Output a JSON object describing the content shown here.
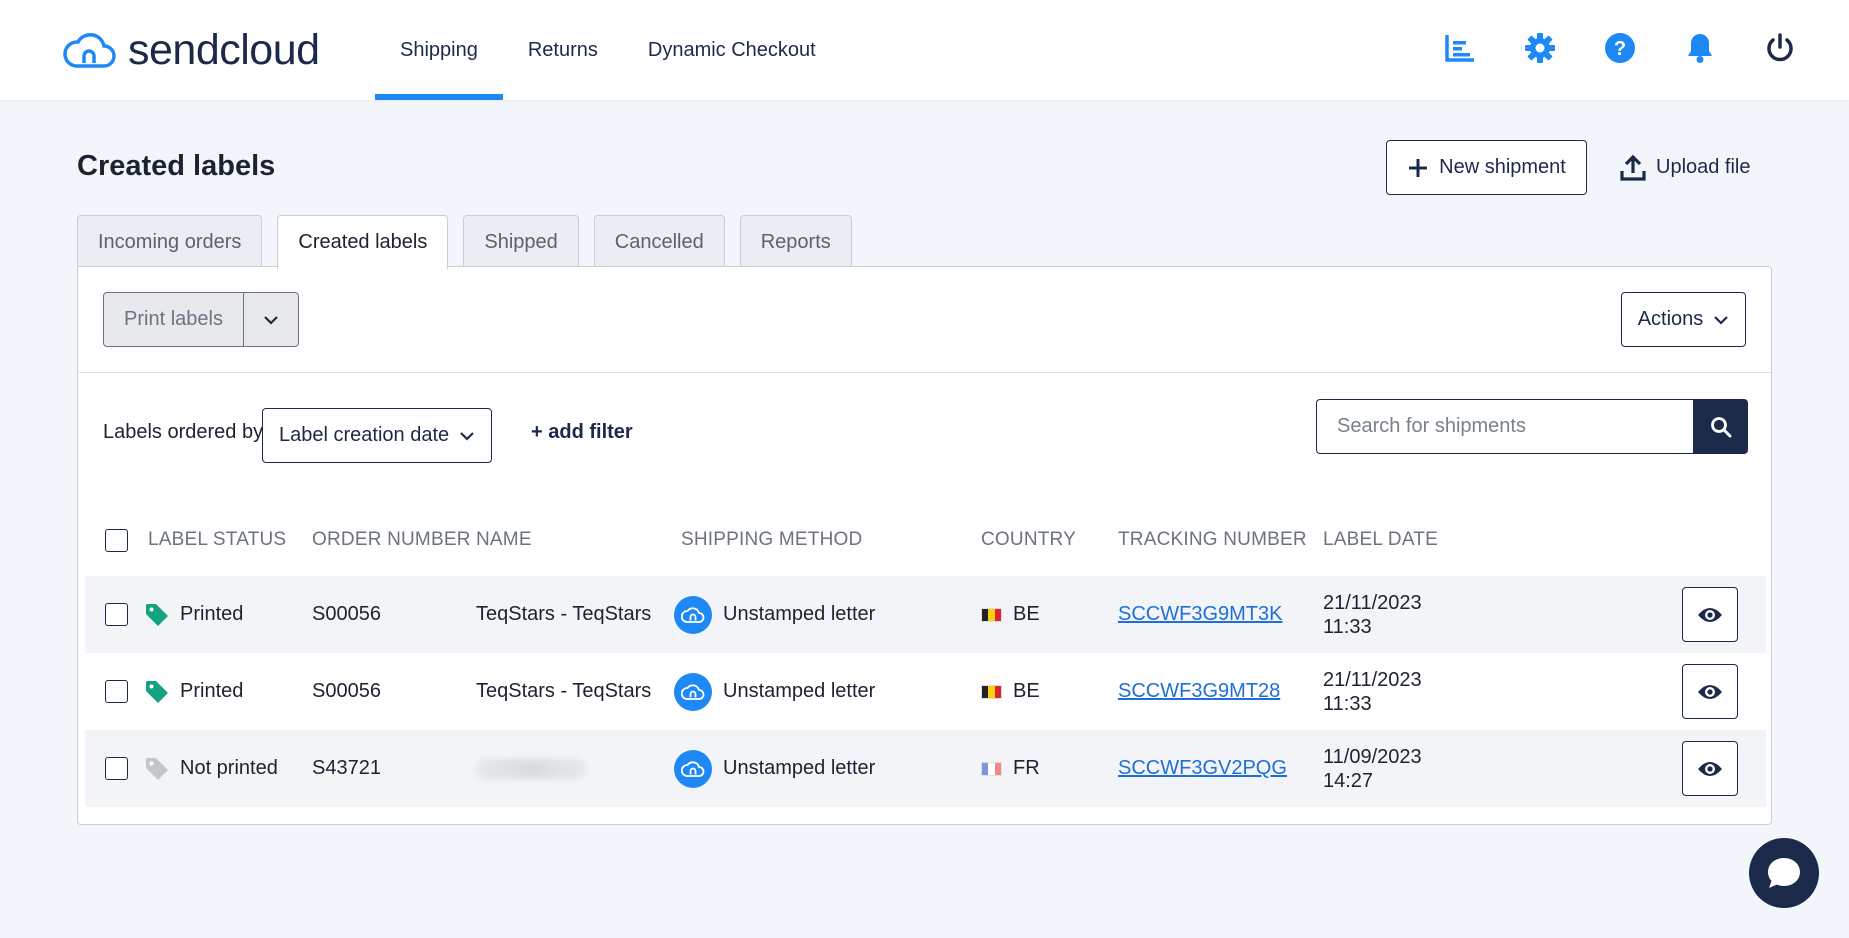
{
  "brand": {
    "name": "sendcloud",
    "accent": "#1e88f5",
    "navy": "#1c2a4a"
  },
  "nav": {
    "items": [
      {
        "label": "Shipping",
        "active": true
      },
      {
        "label": "Returns",
        "active": false
      },
      {
        "label": "Dynamic Checkout",
        "active": false
      }
    ],
    "icons": [
      "analytics-icon",
      "gear-icon",
      "help-icon",
      "bell-icon",
      "power-icon"
    ]
  },
  "page": {
    "title": "Created labels",
    "new_shipment": "New shipment",
    "upload_file": "Upload file"
  },
  "tabs": [
    {
      "label": "Incoming orders",
      "active": false
    },
    {
      "label": "Created labels",
      "active": true
    },
    {
      "label": "Shipped",
      "active": false
    },
    {
      "label": "Cancelled",
      "active": false
    },
    {
      "label": "Reports",
      "active": false
    }
  ],
  "toolbar": {
    "print_labels": "Print labels",
    "actions": "Actions",
    "ordered_by_label": "Labels ordered by",
    "ordered_by_value": "Label creation date",
    "add_filter": "+ add filter",
    "search_placeholder": "Search for shipments"
  },
  "table": {
    "headers": [
      "LABEL STATUS",
      "ORDER NUMBER",
      "NAME",
      "SHIPPING METHOD",
      "COUNTRY",
      "TRACKING NUMBER",
      "LABEL DATE"
    ],
    "rows": [
      {
        "status": "Printed",
        "status_color": "#14a37f",
        "order": "S00056",
        "name": "TeqStars - TeqStars",
        "method": "Unstamped letter",
        "country": "BE",
        "tracking": "SCCWF3G9MT3K",
        "date": "21/11/2023",
        "time": "11:33"
      },
      {
        "status": "Printed",
        "status_color": "#14a37f",
        "order": "S00056",
        "name": "TeqStars - TeqStars",
        "method": "Unstamped letter",
        "country": "BE",
        "tracking": "SCCWF3G9MT28",
        "date": "21/11/2023",
        "time": "11:33"
      },
      {
        "status": "Not printed",
        "status_color": "#c3c7cd",
        "order": "S43721",
        "name": "",
        "method": "Unstamped letter",
        "country": "FR",
        "tracking": "SCCWF3GV2PQG",
        "date": "11/09/2023",
        "time": "14:27"
      }
    ]
  }
}
